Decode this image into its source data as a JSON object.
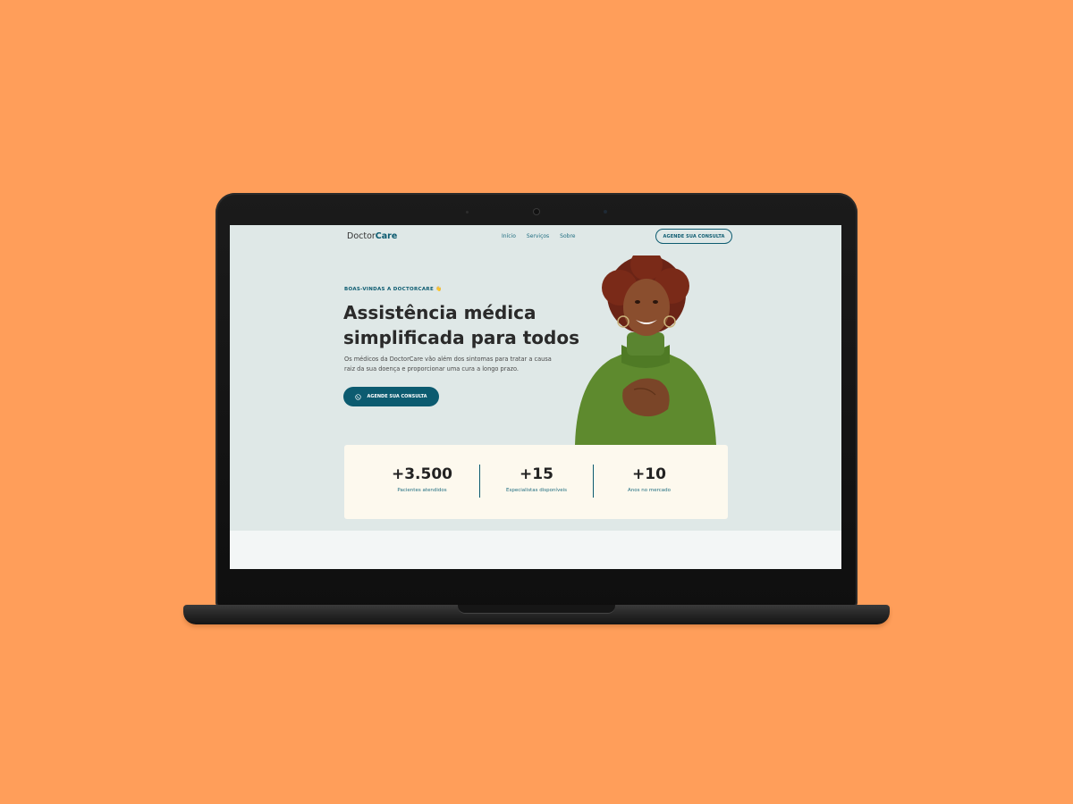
{
  "brand": {
    "logo_part1": "Doctor",
    "logo_part2": "Care",
    "primary_color": "#0C5B70",
    "background_color": "#FF9E5A"
  },
  "nav": {
    "links": [
      "Início",
      "Serviços",
      "Sobre"
    ],
    "cta_label": "AGENDE SUA CONSULTA"
  },
  "hero": {
    "eyebrow": "BOAS-VINDAS A DOCTORCARE 👋",
    "title": "Assistência médica simplificada para todos",
    "description": "Os médicos da DoctorCare vão além dos sintomas para tratar a causa raiz da sua doença e proporcionar uma cura a longo prazo.",
    "cta_label": "AGENDE SUA CONSULTA",
    "cta_icon": "whatsapp-icon"
  },
  "stats": [
    {
      "value": "+3.500",
      "label": "Pacientes atendidos"
    },
    {
      "value": "+15",
      "label": "Especialistas disponíveis"
    },
    {
      "value": "+10",
      "label": "Anos no mercado"
    }
  ]
}
